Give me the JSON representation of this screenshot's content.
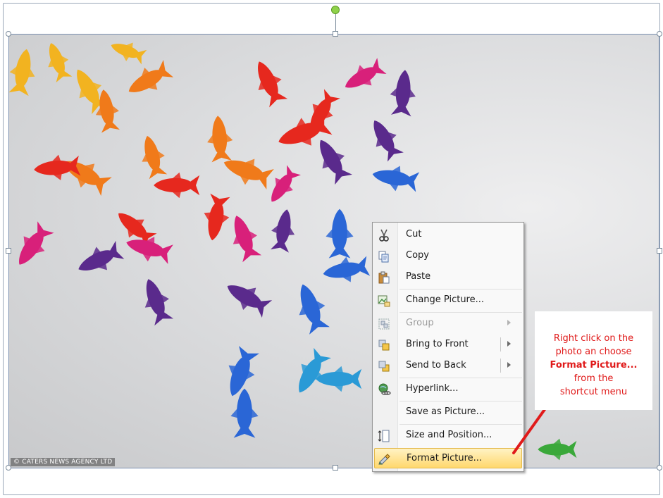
{
  "photo": {
    "credit": "© CATERS NEWS AGENCY LTD",
    "subject": "origami-koi-fish",
    "colors": {
      "yellow": "#f2b320",
      "orange": "#f07a1a",
      "red": "#e6281e",
      "magenta": "#d8207a",
      "purple": "#5a2a8c",
      "blue": "#2a66d6",
      "cyan": "#2a9ad6",
      "green": "#3aa83a"
    }
  },
  "menu": {
    "items": [
      {
        "label": "Cut",
        "icon": "scissors-icon",
        "enabled": true
      },
      {
        "label": "Copy",
        "icon": "copy-icon",
        "enabled": true
      },
      {
        "label": "Paste",
        "icon": "paste-icon",
        "enabled": true
      },
      {
        "label": "Change Picture...",
        "icon": "change-picture-icon",
        "enabled": true
      },
      {
        "label": "Group",
        "icon": "group-icon",
        "enabled": false
      },
      {
        "label": "Bring to Front",
        "icon": "bring-to-front-icon",
        "enabled": true
      },
      {
        "label": "Send to Back",
        "icon": "send-to-back-icon",
        "enabled": true
      },
      {
        "label": "Hyperlink...",
        "icon": "hyperlink-icon",
        "enabled": true
      },
      {
        "label": "Save as Picture...",
        "icon": "",
        "enabled": true
      },
      {
        "label": "Size and Position...",
        "icon": "size-position-icon",
        "enabled": true
      },
      {
        "label": "Format Picture...",
        "icon": "format-picture-icon",
        "enabled": true,
        "highlighted": true
      }
    ]
  },
  "callout": {
    "line1": "Right click on the",
    "line2": "photo an choose",
    "line3": "Format Picture...",
    "line4": "from the",
    "line5": "shortcut menu",
    "color": "#e01a1a"
  }
}
